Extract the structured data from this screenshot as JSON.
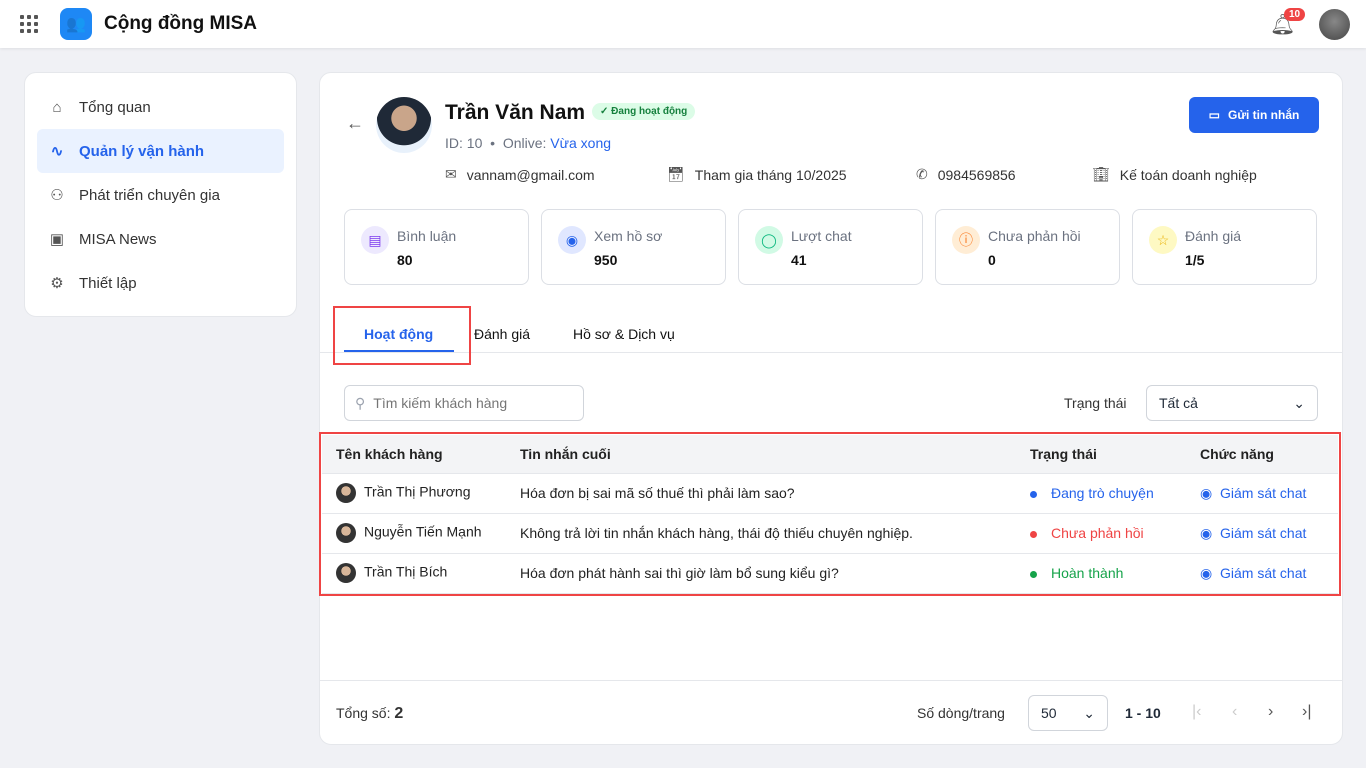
{
  "app": {
    "title": "Cộng đồng MISA",
    "notifications": "10"
  },
  "sidebar": {
    "items": [
      {
        "label": "Tổng quan",
        "icon": "home"
      },
      {
        "label": "Quản lý vận hành",
        "icon": "activity"
      },
      {
        "label": "Phát triển chuyên gia",
        "icon": "users"
      },
      {
        "label": "MISA News",
        "icon": "news"
      },
      {
        "label": "Thiết lập",
        "icon": "gear"
      }
    ]
  },
  "profile": {
    "name": "Trần Văn Nam",
    "status": "Đang hoạt động",
    "id": "ID: 10",
    "online_label": "Onlive:",
    "online_value": "Vừa xong",
    "email": "vannam@gmail.com",
    "joined": "Tham gia tháng 10/2025",
    "phone": "0984569856",
    "job": "Kế toán doanh nghiệp",
    "send_button": "Gửi tin nhắn"
  },
  "stats": [
    {
      "label": "Bình luận",
      "value": "80",
      "color": "#7c3aed"
    },
    {
      "label": "Xem hồ sơ",
      "value": "950",
      "color": "#2563eb"
    },
    {
      "label": "Lượt chat",
      "value": "41",
      "color": "#10b981"
    },
    {
      "label": "Chưa phản hồi",
      "value": "0",
      "color": "#f97316"
    },
    {
      "label": "Đánh giá",
      "value": "1/5",
      "color": "#eab308"
    }
  ],
  "tabs": [
    "Hoạt động",
    "Đánh giá",
    "Hồ sơ & Dịch vụ"
  ],
  "filters": {
    "search_placeholder": "Tìm kiếm khách hàng",
    "status_label": "Trạng thái",
    "status_value": "Tất cả"
  },
  "table": {
    "headers": [
      "Tên khách hàng",
      "Tin nhắn cuối",
      "Trạng thái",
      "Chức năng"
    ],
    "rows": [
      {
        "name": "Trần Thị Phương",
        "message": "Hóa đơn bị sai mã số thuế thì phải làm sao?",
        "status": "Đang trò chuyện",
        "status_color": "#2563eb",
        "action": "Giám sát chat"
      },
      {
        "name": "Nguyễn Tiến Mạnh",
        "message": "Không trả lời tin nhắn khách hàng, thái độ thiếu chuyên nghiệp.",
        "status": "Chưa phản hồi",
        "status_color": "#ef4444",
        "action": "Giám sát chat"
      },
      {
        "name": "Trần Thị Bích",
        "message": "Hóa đơn phát hành sai thì giờ làm bổ sung kiểu gì?",
        "status": "Hoàn thành",
        "status_color": "#16a34a",
        "action": "Giám sát chat"
      }
    ]
  },
  "footer": {
    "total_label": "Tổng số:",
    "total": "2",
    "rows_label": "Số dòng/trang",
    "rows_value": "50",
    "range": "1 - 10"
  }
}
